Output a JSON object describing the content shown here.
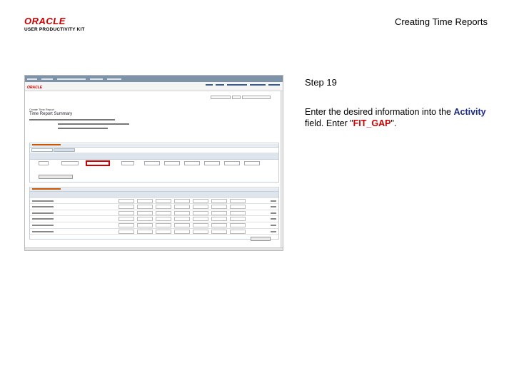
{
  "header": {
    "logo_oracle": "ORACLE",
    "logo_sub": "USER PRODUCTIVITY KIT",
    "doc_title": "Creating Time Reports"
  },
  "step": {
    "label": "Step 19",
    "text_before": "Enter the desired information into the ",
    "field_name": "Activity",
    "text_middle": " field. Enter \"",
    "value": "FIT_GAP",
    "text_after": "\"."
  },
  "screenshot": {
    "brand": "ORACLE",
    "page_caption": "Create Time Report",
    "page_title": "Time Report Summary"
  },
  "colors": {
    "brand_red": "#cc0000",
    "field_blue": "#1a2a8a",
    "highlight_border": "#d00000"
  }
}
